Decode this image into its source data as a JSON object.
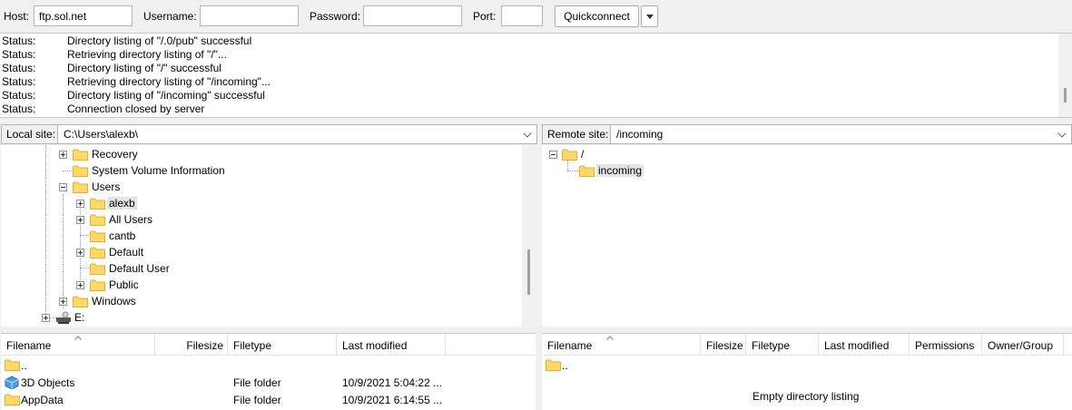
{
  "quickconnect": {
    "host_label": "Host:",
    "host_value": "ftp.sol.net",
    "username_label": "Username:",
    "username_value": "",
    "password_label": "Password:",
    "password_value": "",
    "port_label": "Port:",
    "port_value": "",
    "button_label": "Quickconnect"
  },
  "log": [
    {
      "type": "Status:",
      "message": "Directory listing of \"/.0/pub\" successful"
    },
    {
      "type": "Status:",
      "message": "Retrieving directory listing of \"/\"..."
    },
    {
      "type": "Status:",
      "message": "Directory listing of \"/\" successful"
    },
    {
      "type": "Status:",
      "message": "Retrieving directory listing of \"/incoming\"..."
    },
    {
      "type": "Status:",
      "message": "Directory listing of \"/incoming\" successful"
    },
    {
      "type": "Status:",
      "message": "Connection closed by server"
    }
  ],
  "local": {
    "site_label": "Local site:",
    "path": "C:\\Users\\alexb\\",
    "tree": [
      "Recovery",
      "System Volume Information",
      "Users",
      "alexb",
      "All Users",
      "cantb",
      "Default",
      "Default User",
      "Public",
      "Windows",
      "E:"
    ],
    "columns": [
      "Filename",
      "Filesize",
      "Filetype",
      "Last modified"
    ],
    "files": [
      {
        "name": "..",
        "size": "",
        "type": "",
        "modified": ""
      },
      {
        "name": "3D Objects",
        "size": "",
        "type": "File folder",
        "modified": "10/9/2021 5:04:22 ..."
      },
      {
        "name": "AppData",
        "size": "",
        "type": "File folder",
        "modified": "10/9/2021 6:14:55 ..."
      }
    ]
  },
  "remote": {
    "site_label": "Remote site:",
    "path": "/incoming",
    "tree": [
      "/",
      "incoming"
    ],
    "columns": [
      "Filename",
      "Filesize",
      "Filetype",
      "Last modified",
      "Permissions",
      "Owner/Group"
    ],
    "files": [
      {
        "name": ".."
      }
    ],
    "empty_message": "Empty directory listing"
  },
  "colors": {
    "folder": "#ffd866",
    "folder_edge": "#e0b030",
    "selection": "#e5e5e5"
  }
}
